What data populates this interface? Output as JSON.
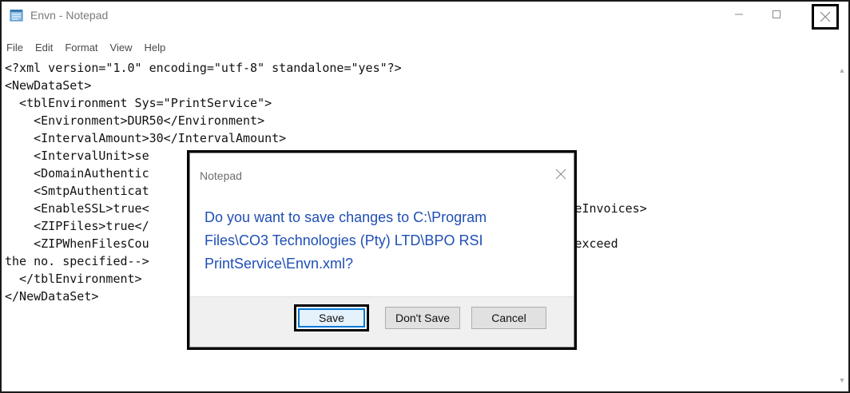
{
  "window": {
    "title": "Envn - Notepad",
    "accent": "#1f4fb5"
  },
  "menu": [
    "File",
    "Edit",
    "Format",
    "View",
    "Help"
  ],
  "editor": {
    "lines": [
      "<?xml version=\"1.0\" encoding=\"utf-8\" standalone=\"yes\"?>",
      "<NewDataSet>",
      "  <tblEnvironment Sys=\"PrintService\">",
      "    <Environment>DUR50</Environment>",
      "    <IntervalAmount>30</IntervalAmount>",
      "    <IntervalUnit>se",
      "    <DomainAuthentic",
      "    <SmtpAuthenticat",
      "    <EnableSSL>true<                                        se</ProcessZeroValueInvoices>",
      "    <ZIPFiles>true</",
      "    <ZIPWhenFilesCou                                        and if attachments exceed",
      "the no. specified-->",
      "  </tblEnvironment>",
      "</NewDataSet>"
    ]
  },
  "dialog": {
    "title": "Notepad",
    "message_lines": [
      "Do you want to save changes to C:\\Program",
      "Files\\CO3 Technologies (Pty) LTD\\BPO RSI",
      "PrintService\\Envn.xml?"
    ],
    "buttons": {
      "save": "Save",
      "dont_save": "Don't Save",
      "cancel": "Cancel"
    }
  }
}
